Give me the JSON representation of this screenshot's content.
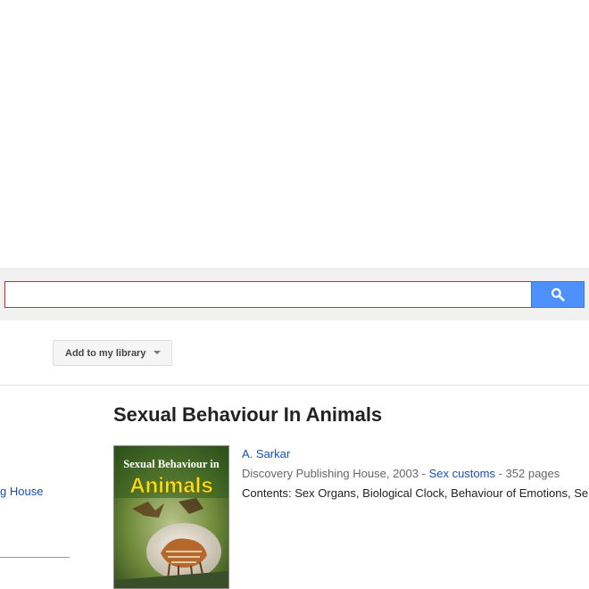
{
  "search": {
    "value": "",
    "placeholder": ""
  },
  "toolbar": {
    "library_label": "Add to my library"
  },
  "sidebar": {
    "link_label": "g House"
  },
  "book": {
    "title": "Sexual Behaviour In Animals",
    "cover_line1": "Sexual Behaviour in",
    "cover_line2": "Animals",
    "author": "A. Sarkar",
    "publisher_year": "Discovery Publishing House, 2003 - ",
    "subject": "Sex customs",
    "pages": " - 352 pages",
    "contents_label": "Contents: ",
    "contents": [
      "Sex Organs",
      "Biological Clock",
      "Behaviour of Emotions",
      "Se"
    ]
  },
  "colors": {
    "search_border": "#e1222a",
    "search_button": "#4d90fe",
    "link": "#1a4fb8",
    "cover_title_yellow": "#f5e21a"
  },
  "icons": {
    "search_button": "search-icon",
    "library_dropdown": "caret-down-icon"
  }
}
